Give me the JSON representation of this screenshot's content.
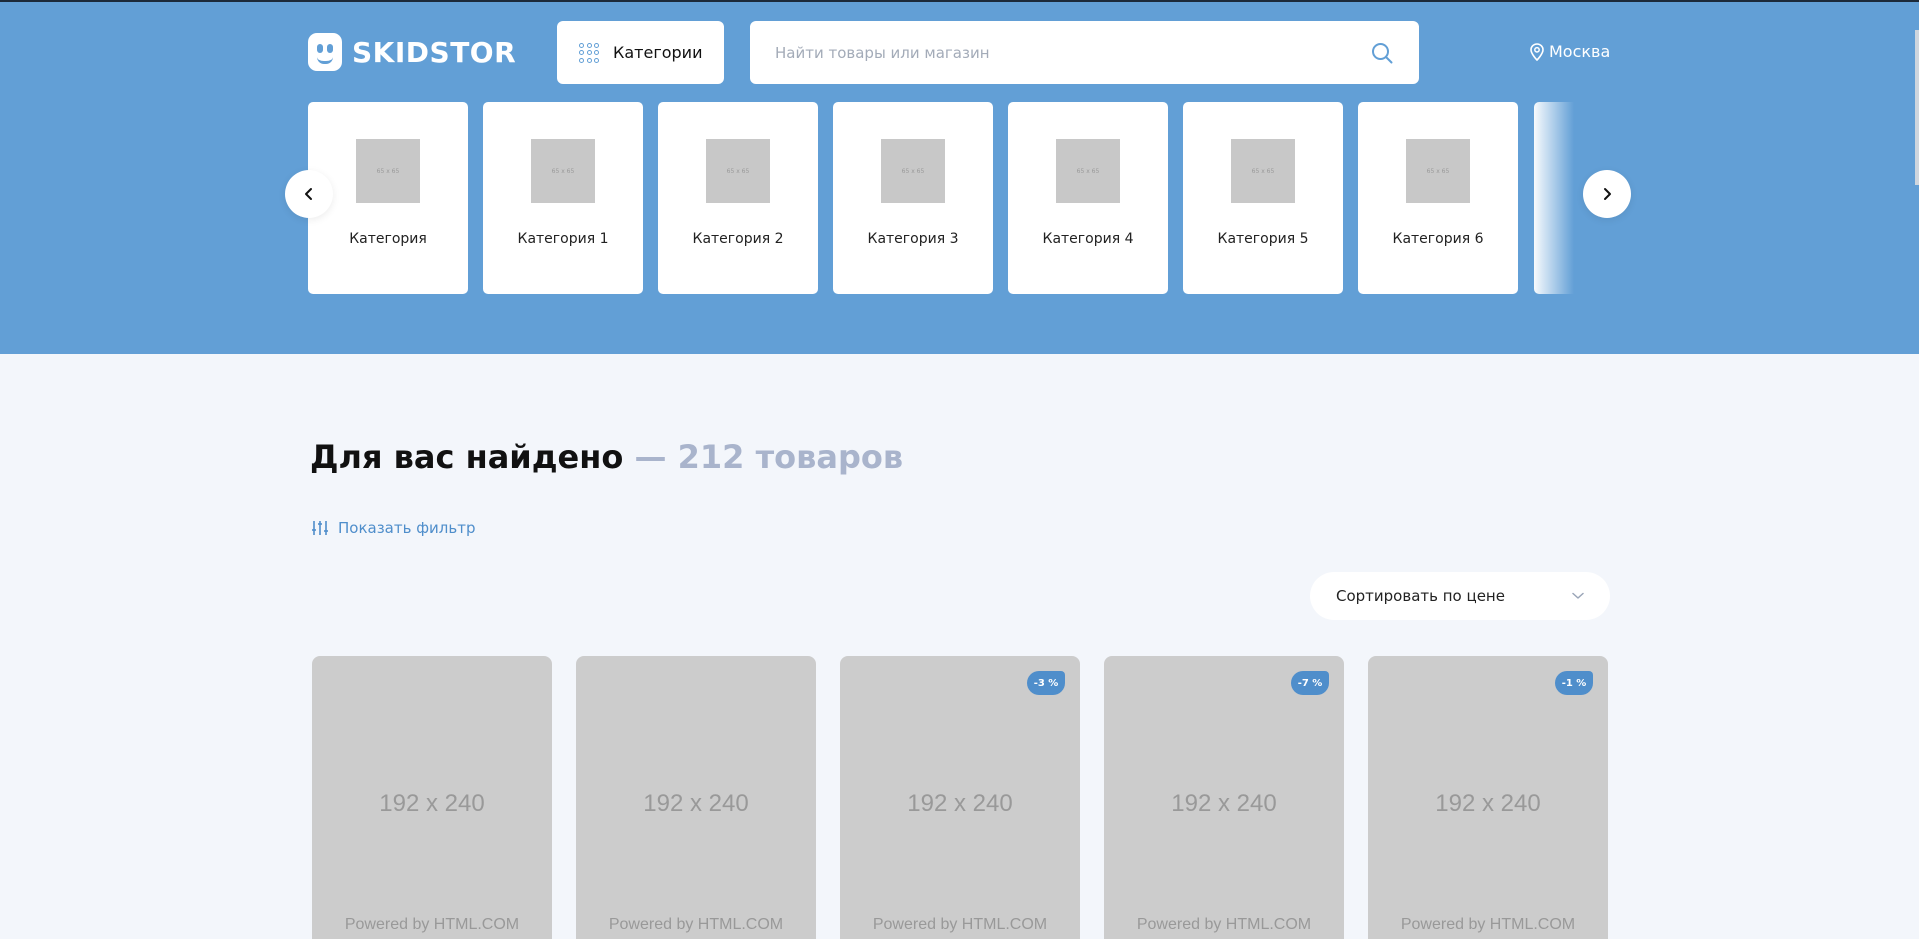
{
  "header": {
    "logo_text": "SKIDSTOR",
    "categories_label": "Категории",
    "search_placeholder": "Найти товары или магазин",
    "city": "Москва"
  },
  "carousel": {
    "thumb_label": "65 x 65",
    "items": [
      {
        "label": "Категория"
      },
      {
        "label": "Категория 1"
      },
      {
        "label": "Категория 2"
      },
      {
        "label": "Категория 3"
      },
      {
        "label": "Категория 4"
      },
      {
        "label": "Категория 5"
      },
      {
        "label": "Категория 6"
      }
    ]
  },
  "results": {
    "title": "Для вас найдено",
    "count": "— 212 товаров",
    "filter_label": "Показать фильтр",
    "sort_label": "Сортировать по цене"
  },
  "products": [
    {
      "size": "192 x 240",
      "powered": "Powered by HTML.COM",
      "discount": ""
    },
    {
      "size": "192 x 240",
      "powered": "Powered by HTML.COM",
      "discount": ""
    },
    {
      "size": "192 x 240",
      "powered": "Powered by HTML.COM",
      "discount": "-3 %"
    },
    {
      "size": "192 x 240",
      "powered": "Powered by HTML.COM",
      "discount": "-7 %"
    },
    {
      "size": "192 x 240",
      "powered": "Powered by HTML.COM",
      "discount": "-1 %"
    }
  ],
  "colors": {
    "primary": "#629fd6",
    "accent": "#4f8ecb",
    "background": "#f3f6fb",
    "muted_count": "#a9b4cc"
  }
}
